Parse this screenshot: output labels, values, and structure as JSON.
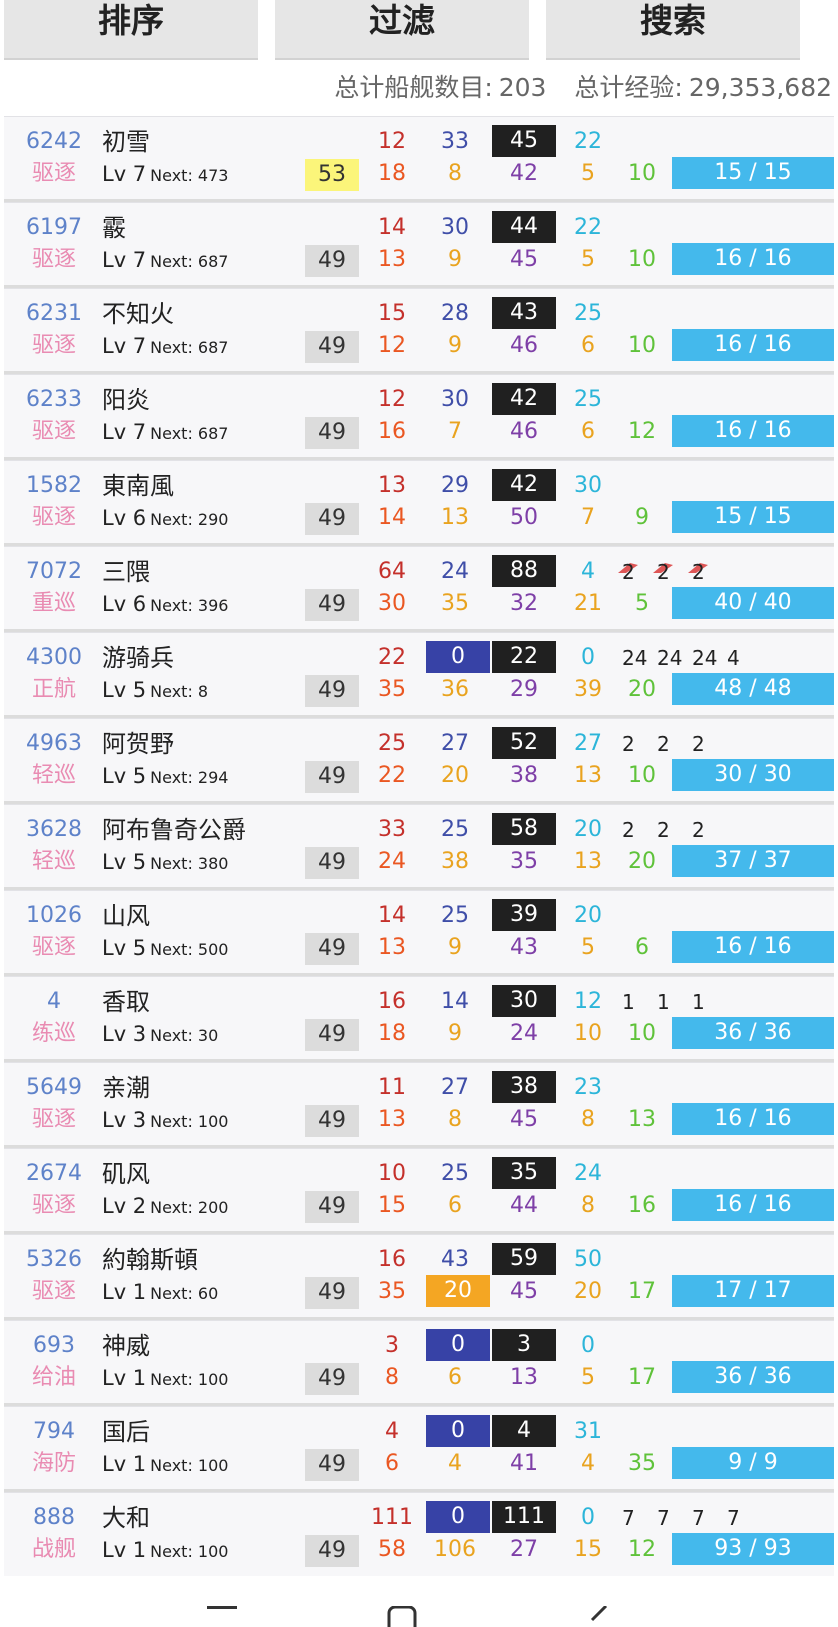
{
  "tabs": [
    {
      "label": "排序"
    },
    {
      "label": "过滤"
    },
    {
      "label": "搜索"
    }
  ],
  "summary": {
    "ship_count_label": "总计船舰数目:",
    "ship_count": "203",
    "exp_label": "总计经验:",
    "exp_total": "29,353,682"
  },
  "ships": [
    {
      "id": "6242",
      "type": "驱逐",
      "name": "初雪",
      "lv": "Lv 7",
      "next": "Next: 473",
      "cond": "53",
      "cond_high": true,
      "s1": "12",
      "s2": "33",
      "s3": "45",
      "s4": "22",
      "b1": "18",
      "b2": "8",
      "b3": "42",
      "b4": "5",
      "luck": "10",
      "slots": [],
      "ammo": "15 / 15"
    },
    {
      "id": "6197",
      "type": "驱逐",
      "name": "霰",
      "lv": "Lv 7",
      "next": "Next: 687",
      "cond": "49",
      "s1": "14",
      "s2": "30",
      "s3": "44",
      "s4": "22",
      "b1": "13",
      "b2": "9",
      "b3": "45",
      "b4": "5",
      "luck": "10",
      "slots": [],
      "ammo": "16 / 16"
    },
    {
      "id": "6231",
      "type": "驱逐",
      "name": "不知火",
      "lv": "Lv 7",
      "next": "Next: 687",
      "cond": "49",
      "s1": "15",
      "s2": "28",
      "s3": "43",
      "s4": "25",
      "b1": "12",
      "b2": "9",
      "b3": "46",
      "b4": "6",
      "luck": "10",
      "slots": [],
      "ammo": "16 / 16"
    },
    {
      "id": "6233",
      "type": "驱逐",
      "name": "阳炎",
      "lv": "Lv 7",
      "next": "Next: 687",
      "cond": "49",
      "s1": "12",
      "s2": "30",
      "s3": "42",
      "s4": "25",
      "b1": "16",
      "b2": "7",
      "b3": "46",
      "b4": "6",
      "luck": "12",
      "slots": [],
      "ammo": "16 / 16"
    },
    {
      "id": "1582",
      "type": "驱逐",
      "name": "東南風",
      "lv": "Lv 6",
      "next": "Next: 290",
      "cond": "49",
      "s1": "13",
      "s2": "29",
      "s3": "42",
      "s4": "30",
      "b1": "14",
      "b2": "13",
      "b3": "50",
      "b4": "7",
      "luck": "9",
      "slots": [],
      "ammo": "15 / 15"
    },
    {
      "id": "7072",
      "type": "重巡",
      "name": "三隈",
      "lv": "Lv 6",
      "next": "Next: 396",
      "cond": "49",
      "s1": "64",
      "s2": "24",
      "s3": "88",
      "s4": "4",
      "b1": "30",
      "b2": "35",
      "b3": "32",
      "b4": "21",
      "luck": "5",
      "slots": [
        "2",
        "2",
        "2"
      ],
      "slot_icons": [
        "seaplane-icon",
        "seaplane-icon",
        "seaplane-icon"
      ],
      "ammo": "40 / 40"
    },
    {
      "id": "4300",
      "type": "正航",
      "name": "游骑兵",
      "lv": "Lv 5",
      "next": "Next: 8",
      "cond": "49",
      "s1": "22",
      "s2": "0",
      "s2_zero": true,
      "s3": "22",
      "s4": "0",
      "b1": "35",
      "b2": "36",
      "b3": "29",
      "b4": "39",
      "luck": "20",
      "slots": [
        "24",
        "24",
        "24",
        "4"
      ],
      "ammo": "48 / 48"
    },
    {
      "id": "4963",
      "type": "轻巡",
      "name": "阿贺野",
      "lv": "Lv 5",
      "next": "Next: 294",
      "cond": "49",
      "s1": "25",
      "s2": "27",
      "s3": "52",
      "s4": "27",
      "b1": "22",
      "b2": "20",
      "b3": "38",
      "b4": "13",
      "luck": "10",
      "slots": [
        "2",
        "2",
        "2"
      ],
      "ammo": "30 / 30"
    },
    {
      "id": "3628",
      "type": "轻巡",
      "name": "阿布鲁奇公爵",
      "lv": "Lv 5",
      "next": "Next: 380",
      "cond": "49",
      "s1": "33",
      "s2": "25",
      "s3": "58",
      "s4": "20",
      "b1": "24",
      "b2": "38",
      "b3": "35",
      "b4": "13",
      "luck": "20",
      "slots": [
        "2",
        "2",
        "2"
      ],
      "ammo": "37 / 37"
    },
    {
      "id": "1026",
      "type": "驱逐",
      "name": "山风",
      "lv": "Lv 5",
      "next": "Next: 500",
      "cond": "49",
      "s1": "14",
      "s2": "25",
      "s3": "39",
      "s4": "20",
      "b1": "13",
      "b2": "9",
      "b3": "43",
      "b4": "5",
      "luck": "6",
      "slots": [],
      "ammo": "16 / 16"
    },
    {
      "id": "4",
      "type": "练巡",
      "name": "香取",
      "lv": "Lv 3",
      "next": "Next: 30",
      "cond": "49",
      "s1": "16",
      "s2": "14",
      "s3": "30",
      "s4": "12",
      "b1": "18",
      "b2": "9",
      "b3": "24",
      "b4": "10",
      "luck": "10",
      "slots": [
        "1",
        "1",
        "1"
      ],
      "ammo": "36 / 36"
    },
    {
      "id": "5649",
      "type": "驱逐",
      "name": "亲潮",
      "lv": "Lv 3",
      "next": "Next: 100",
      "cond": "49",
      "s1": "11",
      "s2": "27",
      "s3": "38",
      "s4": "23",
      "b1": "13",
      "b2": "8",
      "b3": "45",
      "b4": "8",
      "luck": "13",
      "slots": [],
      "ammo": "16 / 16"
    },
    {
      "id": "2674",
      "type": "驱逐",
      "name": "矶风",
      "lv": "Lv 2",
      "next": "Next: 200",
      "cond": "49",
      "s1": "10",
      "s2": "25",
      "s3": "35",
      "s4": "24",
      "b1": "15",
      "b2": "6",
      "b3": "44",
      "b4": "8",
      "luck": "16",
      "slots": [],
      "ammo": "16 / 16"
    },
    {
      "id": "5326",
      "type": "驱逐",
      "name": "約翰斯頓",
      "lv": "Lv 1",
      "next": "Next: 60",
      "cond": "49",
      "s1": "16",
      "s2": "43",
      "s3": "59",
      "s4": "50",
      "b1": "35",
      "b2": "20",
      "b2_hl": true,
      "b3": "45",
      "b4": "20",
      "luck": "17",
      "slots": [],
      "ammo": "17 / 17"
    },
    {
      "id": "693",
      "type": "给油",
      "name": "神威",
      "lv": "Lv 1",
      "next": "Next: 100",
      "cond": "49",
      "s1": "3",
      "s2": "0",
      "s2_zero": true,
      "s3": "3",
      "s4": "0",
      "b1": "8",
      "b2": "6",
      "b3": "13",
      "b4": "5",
      "luck": "17",
      "slots": [],
      "ammo": "36 / 36"
    },
    {
      "id": "794",
      "type": "海防",
      "name": "国后",
      "lv": "Lv 1",
      "next": "Next: 100",
      "cond": "49",
      "s1": "4",
      "s2": "0",
      "s2_zero": true,
      "s3": "4",
      "s4": "31",
      "b1": "6",
      "b2": "4",
      "b3": "41",
      "b4": "4",
      "luck": "35",
      "slots": [],
      "ammo": "9 / 9"
    },
    {
      "id": "888",
      "type": "战舰",
      "name": "大和",
      "lv": "Lv 1",
      "next": "Next: 100",
      "cond": "49",
      "s1": "111",
      "s2": "0",
      "s2_zero": true,
      "s3": "111",
      "s4": "0",
      "b1": "58",
      "b2": "106",
      "b3": "27",
      "b4": "15",
      "luck": "12",
      "slots": [
        "7",
        "7",
        "7",
        "7"
      ],
      "ammo": "93 / 93"
    }
  ],
  "nav": [
    {
      "icon": "menu-icon"
    },
    {
      "icon": "home-icon"
    },
    {
      "icon": "back-icon"
    }
  ]
}
